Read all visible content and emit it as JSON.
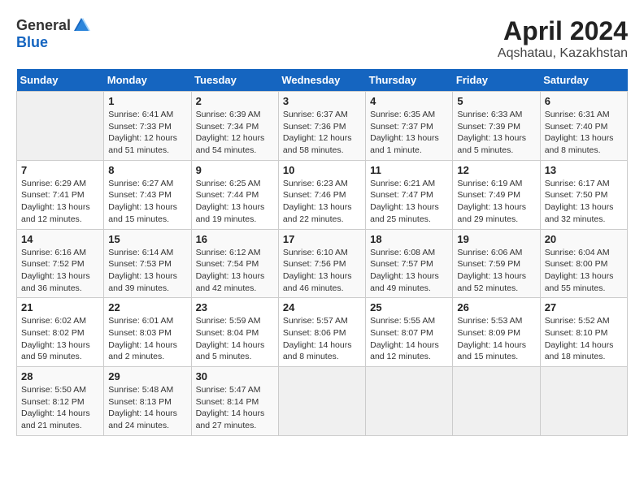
{
  "header": {
    "logo_general": "General",
    "logo_blue": "Blue",
    "title": "April 2024",
    "subtitle": "Aqshatau, Kazakhstan"
  },
  "days_of_week": [
    "Sunday",
    "Monday",
    "Tuesday",
    "Wednesday",
    "Thursday",
    "Friday",
    "Saturday"
  ],
  "weeks": [
    [
      {
        "day": "",
        "info": ""
      },
      {
        "day": "1",
        "info": "Sunrise: 6:41 AM\nSunset: 7:33 PM\nDaylight: 12 hours\nand 51 minutes."
      },
      {
        "day": "2",
        "info": "Sunrise: 6:39 AM\nSunset: 7:34 PM\nDaylight: 12 hours\nand 54 minutes."
      },
      {
        "day": "3",
        "info": "Sunrise: 6:37 AM\nSunset: 7:36 PM\nDaylight: 12 hours\nand 58 minutes."
      },
      {
        "day": "4",
        "info": "Sunrise: 6:35 AM\nSunset: 7:37 PM\nDaylight: 13 hours\nand 1 minute."
      },
      {
        "day": "5",
        "info": "Sunrise: 6:33 AM\nSunset: 7:39 PM\nDaylight: 13 hours\nand 5 minutes."
      },
      {
        "day": "6",
        "info": "Sunrise: 6:31 AM\nSunset: 7:40 PM\nDaylight: 13 hours\nand 8 minutes."
      }
    ],
    [
      {
        "day": "7",
        "info": "Sunrise: 6:29 AM\nSunset: 7:41 PM\nDaylight: 13 hours\nand 12 minutes."
      },
      {
        "day": "8",
        "info": "Sunrise: 6:27 AM\nSunset: 7:43 PM\nDaylight: 13 hours\nand 15 minutes."
      },
      {
        "day": "9",
        "info": "Sunrise: 6:25 AM\nSunset: 7:44 PM\nDaylight: 13 hours\nand 19 minutes."
      },
      {
        "day": "10",
        "info": "Sunrise: 6:23 AM\nSunset: 7:46 PM\nDaylight: 13 hours\nand 22 minutes."
      },
      {
        "day": "11",
        "info": "Sunrise: 6:21 AM\nSunset: 7:47 PM\nDaylight: 13 hours\nand 25 minutes."
      },
      {
        "day": "12",
        "info": "Sunrise: 6:19 AM\nSunset: 7:49 PM\nDaylight: 13 hours\nand 29 minutes."
      },
      {
        "day": "13",
        "info": "Sunrise: 6:17 AM\nSunset: 7:50 PM\nDaylight: 13 hours\nand 32 minutes."
      }
    ],
    [
      {
        "day": "14",
        "info": "Sunrise: 6:16 AM\nSunset: 7:52 PM\nDaylight: 13 hours\nand 36 minutes."
      },
      {
        "day": "15",
        "info": "Sunrise: 6:14 AM\nSunset: 7:53 PM\nDaylight: 13 hours\nand 39 minutes."
      },
      {
        "day": "16",
        "info": "Sunrise: 6:12 AM\nSunset: 7:54 PM\nDaylight: 13 hours\nand 42 minutes."
      },
      {
        "day": "17",
        "info": "Sunrise: 6:10 AM\nSunset: 7:56 PM\nDaylight: 13 hours\nand 46 minutes."
      },
      {
        "day": "18",
        "info": "Sunrise: 6:08 AM\nSunset: 7:57 PM\nDaylight: 13 hours\nand 49 minutes."
      },
      {
        "day": "19",
        "info": "Sunrise: 6:06 AM\nSunset: 7:59 PM\nDaylight: 13 hours\nand 52 minutes."
      },
      {
        "day": "20",
        "info": "Sunrise: 6:04 AM\nSunset: 8:00 PM\nDaylight: 13 hours\nand 55 minutes."
      }
    ],
    [
      {
        "day": "21",
        "info": "Sunrise: 6:02 AM\nSunset: 8:02 PM\nDaylight: 13 hours\nand 59 minutes."
      },
      {
        "day": "22",
        "info": "Sunrise: 6:01 AM\nSunset: 8:03 PM\nDaylight: 14 hours\nand 2 minutes."
      },
      {
        "day": "23",
        "info": "Sunrise: 5:59 AM\nSunset: 8:04 PM\nDaylight: 14 hours\nand 5 minutes."
      },
      {
        "day": "24",
        "info": "Sunrise: 5:57 AM\nSunset: 8:06 PM\nDaylight: 14 hours\nand 8 minutes."
      },
      {
        "day": "25",
        "info": "Sunrise: 5:55 AM\nSunset: 8:07 PM\nDaylight: 14 hours\nand 12 minutes."
      },
      {
        "day": "26",
        "info": "Sunrise: 5:53 AM\nSunset: 8:09 PM\nDaylight: 14 hours\nand 15 minutes."
      },
      {
        "day": "27",
        "info": "Sunrise: 5:52 AM\nSunset: 8:10 PM\nDaylight: 14 hours\nand 18 minutes."
      }
    ],
    [
      {
        "day": "28",
        "info": "Sunrise: 5:50 AM\nSunset: 8:12 PM\nDaylight: 14 hours\nand 21 minutes."
      },
      {
        "day": "29",
        "info": "Sunrise: 5:48 AM\nSunset: 8:13 PM\nDaylight: 14 hours\nand 24 minutes."
      },
      {
        "day": "30",
        "info": "Sunrise: 5:47 AM\nSunset: 8:14 PM\nDaylight: 14 hours\nand 27 minutes."
      },
      {
        "day": "",
        "info": ""
      },
      {
        "day": "",
        "info": ""
      },
      {
        "day": "",
        "info": ""
      },
      {
        "day": "",
        "info": ""
      }
    ]
  ]
}
